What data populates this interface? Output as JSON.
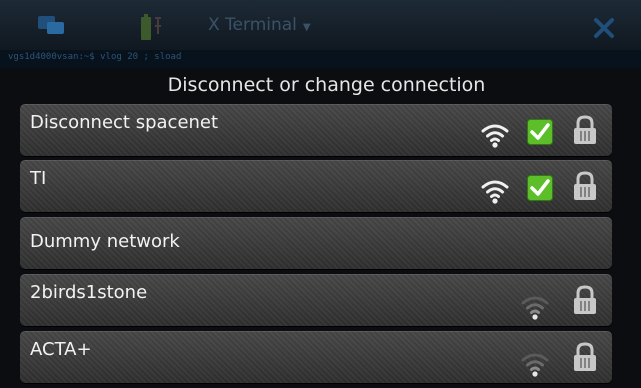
{
  "background": {
    "window_title": "X Terminal",
    "command_line": "vgs1d4000vsan:~$ vlog 20 ; sload",
    "app_icon": "terminal-app-icon",
    "battery_icon": "battery-icon",
    "close_icon": "close-icon"
  },
  "dialog": {
    "title": "Disconnect or change connection",
    "rows": [
      {
        "label": "Disconnect spacenet",
        "wifi": "strong",
        "checked": true,
        "locked": true
      },
      {
        "label": "TI",
        "wifi": "strong",
        "checked": true,
        "locked": true
      },
      {
        "label": "Dummy network",
        "wifi": "none",
        "checked": false,
        "locked": false
      },
      {
        "label": "2birds1stone",
        "wifi": "weak",
        "checked": false,
        "locked": true
      },
      {
        "label": "ACTA+",
        "wifi": "weak",
        "checked": false,
        "locked": true
      }
    ]
  },
  "colors": {
    "check_green": "#5cbf2a",
    "wifi_strong": "#f0f0f0",
    "wifi_weak_dim": "#6a6a6a",
    "lock": "#c8c8c8"
  }
}
